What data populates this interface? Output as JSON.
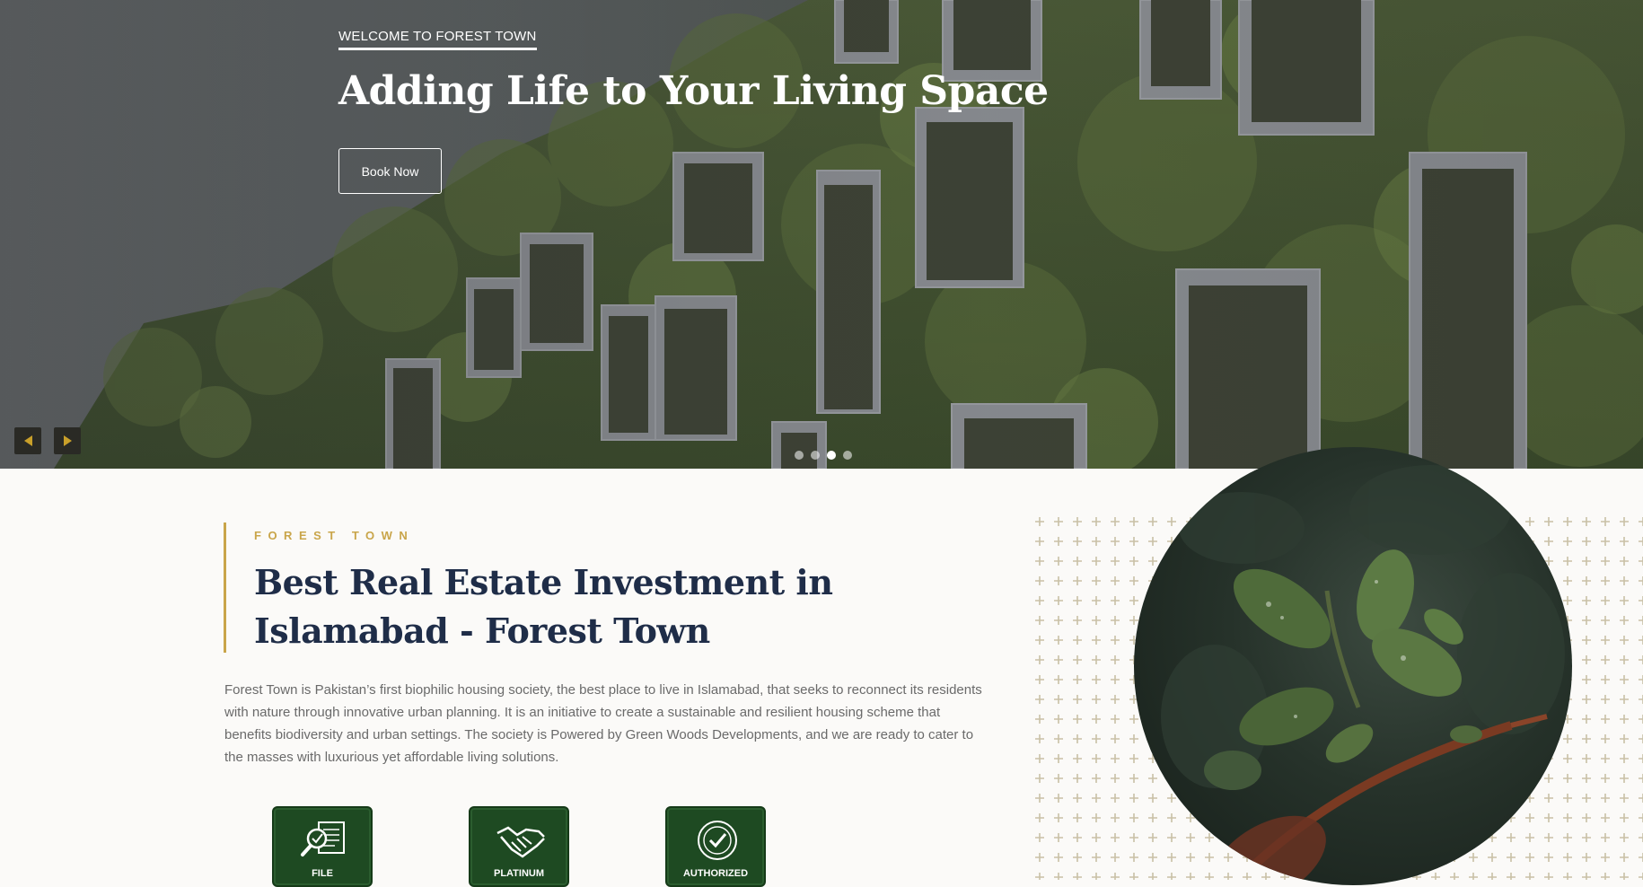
{
  "hero": {
    "eyebrow": "WELCOME TO FOREST TOWN",
    "title": "Adding Life to Your Living Space",
    "cta_label": "Book Now",
    "slides_count": 4,
    "active_slide": 3,
    "prev_icon": "caret-left-icon",
    "next_icon": "caret-right-icon"
  },
  "about": {
    "eyebrow": "FOREST TOWN",
    "title": "Best Real Estate Investment in Islamabad - Forest Town",
    "description": "Forest Town is Pakistan’s first biophilic housing society, the best place to live in Islamabad, that seeks to reconnect its residents with nature through innovative urban planning. It is an initiative to create a sustainable and resilient housing scheme that benefits biodiversity and urban settings. The society is Powered by Green Woods Developments, and we are ready to cater to the masses with luxurious yet affordable living solutions."
  },
  "badges": [
    {
      "label": "FILE",
      "icon": "file-verification-icon"
    },
    {
      "label": "PLATINUM",
      "icon": "handshake-icon"
    },
    {
      "label": "AUTHORIZED",
      "icon": "authorized-dealer-seal-icon"
    }
  ],
  "colors": {
    "accent_gold": "#c9a54a",
    "heading_navy": "#1f2d48",
    "badge_green": "#1e4a22",
    "body_text": "#6a6a6a",
    "arrow_bg": "#2a2a25"
  }
}
